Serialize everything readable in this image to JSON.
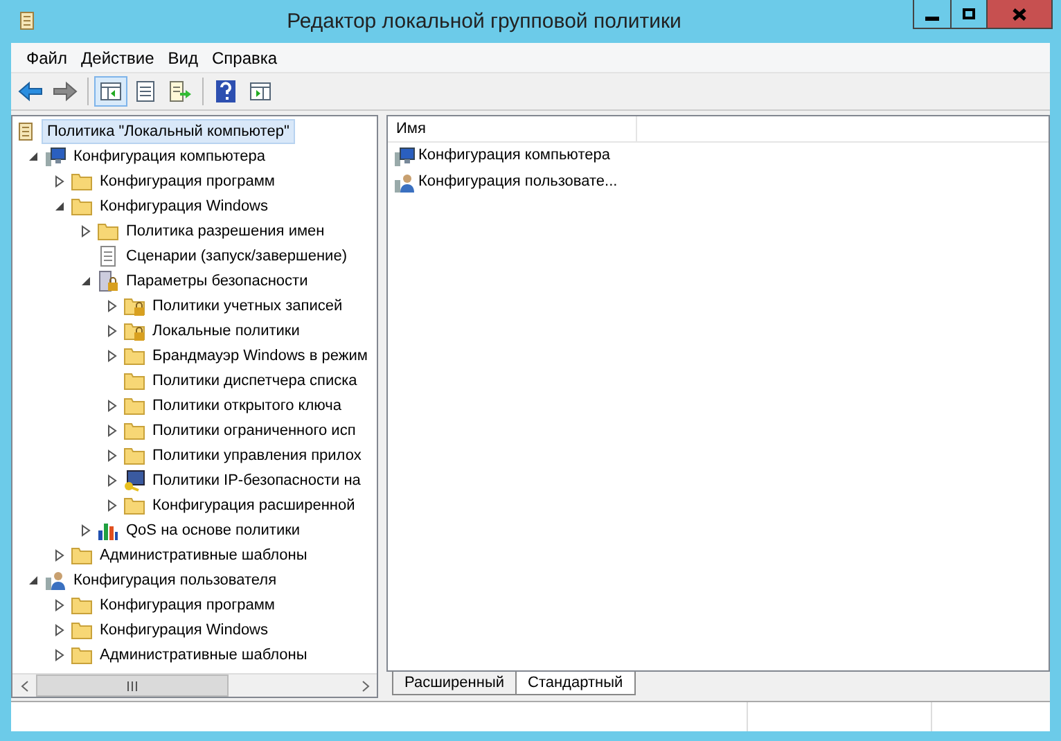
{
  "window": {
    "title": "Редактор локальной групповой политики"
  },
  "menu": [
    "Файл",
    "Действие",
    "Вид",
    "Справка"
  ],
  "toolbar": [
    {
      "kind": "back",
      "disabled": false
    },
    {
      "kind": "forward",
      "disabled": true
    },
    {
      "kind": "tree",
      "selected": true
    },
    {
      "kind": "properties",
      "selected": false
    },
    {
      "kind": "export",
      "selected": false
    },
    {
      "kind": "help",
      "selected": false
    },
    {
      "kind": "action",
      "selected": false
    }
  ],
  "tree": {
    "label": "Политика \"Локальный компьютер\"",
    "selected": true,
    "children": [
      {
        "label": "Конфигурация компьютера",
        "kind": "computer",
        "has_children": true,
        "expanded": true,
        "children": [
          {
            "label": "Конфигурация программ",
            "kind": "folder",
            "has_children": true,
            "expanded": false
          },
          {
            "label": "Конфигурация Windows",
            "kind": "folder",
            "has_children": true,
            "expanded": true,
            "children": [
              {
                "label": "Политика разрешения имен",
                "kind": "folder",
                "has_children": true,
                "expanded": false
              },
              {
                "label": "Сценарии (запуск/завершение)",
                "kind": "script",
                "has_children": false,
                "expanded": false
              },
              {
                "label": "Параметры безопасности",
                "kind": "security",
                "has_children": true,
                "expanded": true,
                "children": [
                  {
                    "label": "Политики учетных записей",
                    "kind": "lockedfolder",
                    "has_children": true,
                    "expanded": false
                  },
                  {
                    "label": "Локальные политики",
                    "kind": "lockedfolder",
                    "has_children": true,
                    "expanded": false
                  },
                  {
                    "label": "Брандмауэр Windows в режим",
                    "kind": "folder",
                    "has_children": true,
                    "expanded": false
                  },
                  {
                    "label": "Политики диспетчера списка",
                    "kind": "folder",
                    "has_children": false,
                    "expanded": false
                  },
                  {
                    "label": "Политики открытого ключа",
                    "kind": "folder",
                    "has_children": true,
                    "expanded": false
                  },
                  {
                    "label": "Политики ограниченного исп",
                    "kind": "folder",
                    "has_children": true,
                    "expanded": false
                  },
                  {
                    "label": "Политики управления прилох",
                    "kind": "folder",
                    "has_children": true,
                    "expanded": false
                  },
                  {
                    "label": "Политики IP-безопасности на",
                    "kind": "ipsec",
                    "has_children": true,
                    "expanded": false
                  },
                  {
                    "label": "Конфигурация расширенной",
                    "kind": "folder",
                    "has_children": true,
                    "expanded": false
                  }
                ]
              },
              {
                "label": "QoS на основе политики",
                "kind": "qos",
                "has_children": true,
                "expanded": false
              }
            ]
          },
          {
            "label": "Административные шаблоны",
            "kind": "folder",
            "has_children": true,
            "expanded": false
          }
        ]
      },
      {
        "label": "Конфигурация пользователя",
        "kind": "user",
        "has_children": true,
        "expanded": true,
        "children": [
          {
            "label": "Конфигурация программ",
            "kind": "folder",
            "has_children": true,
            "expanded": false
          },
          {
            "label": "Конфигурация Windows",
            "kind": "folder",
            "has_children": true,
            "expanded": false
          },
          {
            "label": "Административные шаблоны",
            "kind": "folder",
            "has_children": true,
            "expanded": false
          }
        ]
      }
    ]
  },
  "list": {
    "columns": [
      "Имя"
    ],
    "rows": [
      {
        "label": "Конфигурация компьютера",
        "kind": "computer"
      },
      {
        "label": "Конфигурация пользовате...",
        "kind": "user"
      }
    ]
  },
  "tabs": [
    {
      "label": "Расширенный",
      "selected": false
    },
    {
      "label": "Стандартный",
      "selected": true
    }
  ]
}
